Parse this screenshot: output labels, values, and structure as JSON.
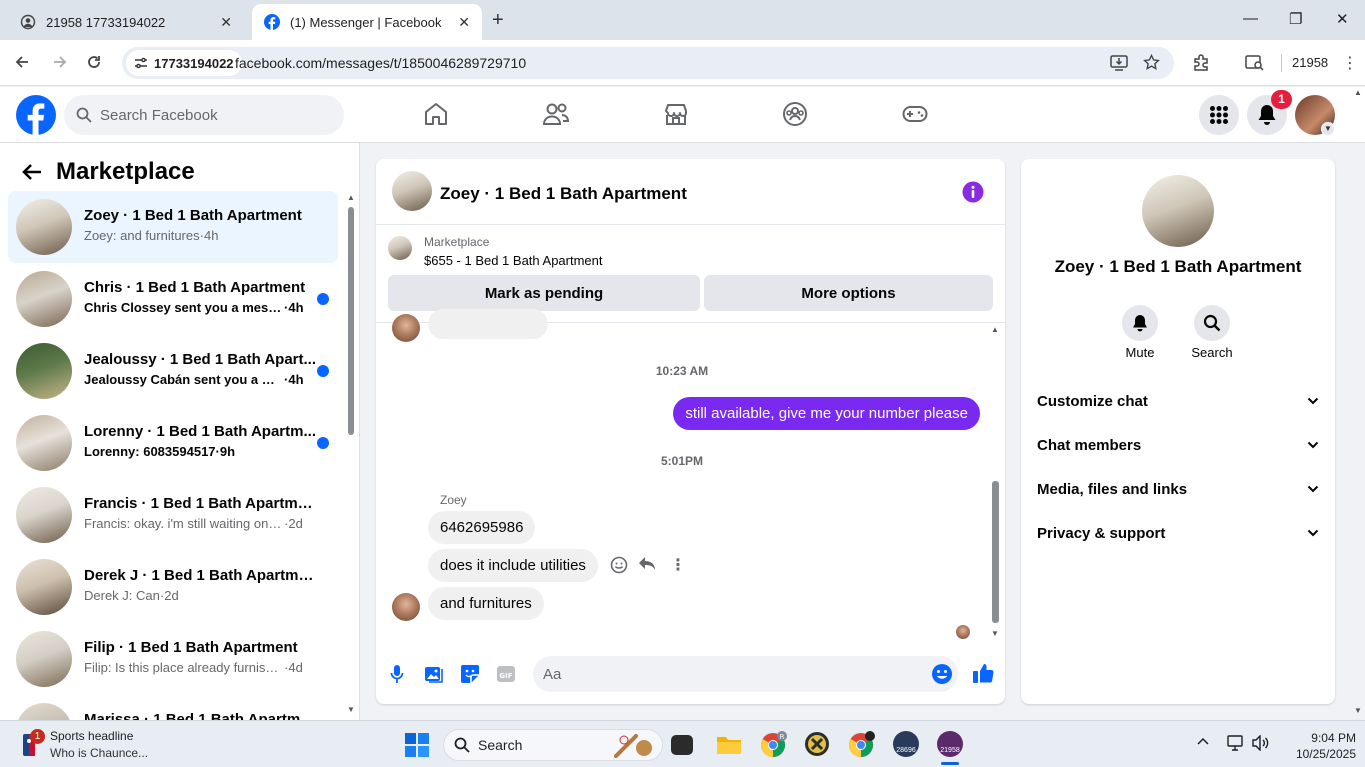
{
  "browser": {
    "tabs": [
      {
        "title": "21958 17733194022",
        "icon": "globe-icon"
      },
      {
        "title": "(1) Messenger | Facebook",
        "icon": "facebook-icon"
      }
    ],
    "site_badge": "17733194022",
    "url": "facebook.com/messages/t/1850046289729710",
    "profile_name": "21958"
  },
  "fb": {
    "search_placeholder": "Search Facebook",
    "notification_count": "1",
    "brand_color": "#0866ff"
  },
  "sidebar": {
    "title": "Marketplace",
    "conversations": [
      {
        "name": "Zoey · 1 Bed 1 Bath Apartment",
        "preview": "Zoey: and furnitures",
        "time": "4h",
        "unread": false,
        "active": true
      },
      {
        "name": "Chris · 1 Bed 1 Bath Apartment",
        "preview": "Chris Clossey sent you a messag...",
        "time": "4h",
        "unread": true,
        "active": false
      },
      {
        "name": "Jealoussy · 1 Bed 1 Bath Apart...",
        "preview": "Jealoussy Cabán sent you a mes...",
        "time": "4h",
        "unread": true,
        "active": false
      },
      {
        "name": "Lorenny · 1 Bed 1 Bath Apartm...",
        "preview": "Lorenny: 6083594517",
        "time": "9h",
        "unread": true,
        "active": false
      },
      {
        "name": "Francis · 1 Bed 1 Bath Apartment",
        "preview": "Francis: okay. i'm still waiting on th...",
        "time": "2d",
        "unread": false,
        "active": false
      },
      {
        "name": "Derek J · 1 Bed 1 Bath Apartment",
        "preview": "Derek J: Can",
        "time": "2d",
        "unread": false,
        "active": false
      },
      {
        "name": "Filip · 1 Bed 1 Bath Apartment",
        "preview": "Filip: Is this place already furnished?",
        "time": "4d",
        "unread": false,
        "active": false
      },
      {
        "name": "Marissa · 1 Bed 1 Bath Apartm...",
        "preview": "",
        "time": "",
        "unread": false,
        "active": false
      }
    ]
  },
  "chat": {
    "title": "Zoey · 1 Bed 1 Bath Apartment",
    "listing_label": "Marketplace",
    "listing_price": "$655 - 1 Bed 1 Bath Apartment",
    "mark_pending_label": "Mark as pending",
    "more_options_label": "More options",
    "timestamp_1": "10:23 AM",
    "outgoing_1": "still available, give me your number please",
    "timestamp_2": "5:01PM",
    "sender_name": "Zoey",
    "incoming": [
      "6462695986",
      "does it include utilities",
      "and furnitures"
    ],
    "input_placeholder": "Aa",
    "accent_color": "#7a29f0"
  },
  "info_panel": {
    "name": "Zoey · 1 Bed 1 Bath Apartment",
    "mute_label": "Mute",
    "search_label": "Search",
    "sections": [
      "Customize chat",
      "Chat members",
      "Media, files and links",
      "Privacy & support"
    ]
  },
  "taskbar": {
    "news_title": "Sports headline",
    "news_desc": "Who is Chaunce...",
    "news_badge": "1",
    "search_label": "Search",
    "badge_21958": "21958",
    "badge_28696": "28696",
    "time": "9:04 PM",
    "date": "10/25/2025"
  }
}
